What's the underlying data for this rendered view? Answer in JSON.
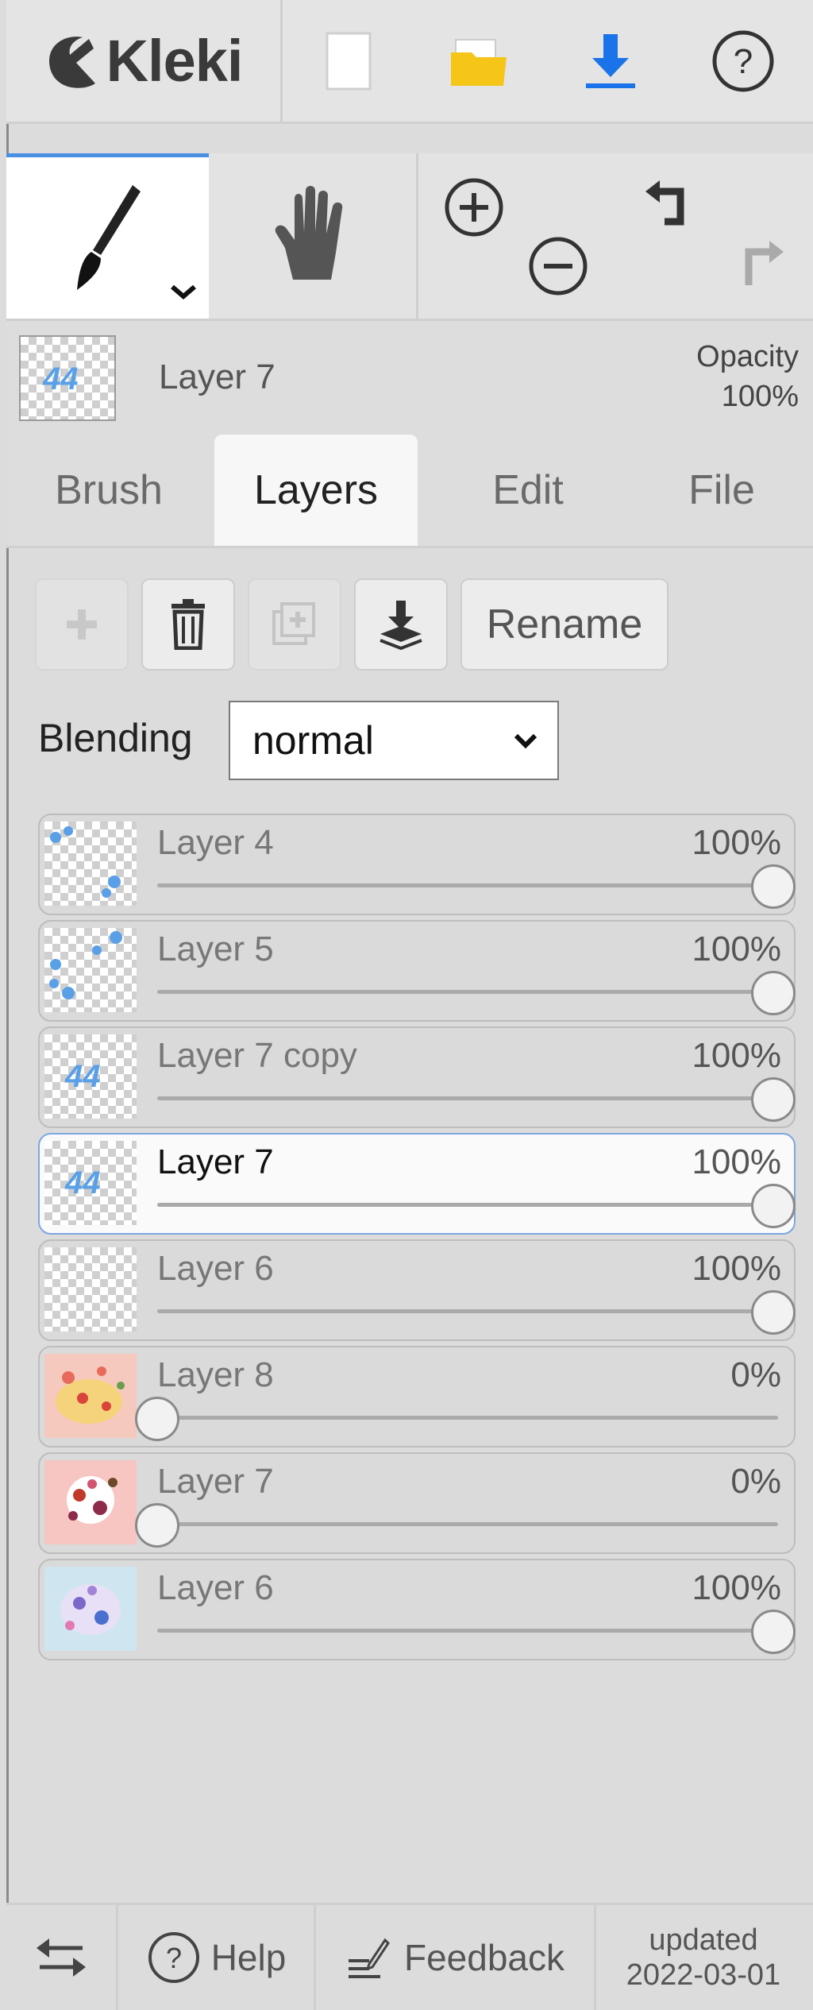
{
  "app": {
    "name": "Kleki"
  },
  "toolbar": {
    "icons": [
      "new-image-icon",
      "open-folder-icon",
      "download-icon",
      "help-icon"
    ],
    "accent_color": "#1a73e8",
    "folder_color": "#f5c518"
  },
  "tools": [
    "brush-tool-icon",
    "hand-tool-icon",
    "zoom-in-icon",
    "zoom-out-icon",
    "undo-icon",
    "redo-icon"
  ],
  "current_layer": {
    "name": "Layer 7",
    "opacity_label": "Opacity",
    "opacity_value": "100%"
  },
  "tabs": [
    {
      "label": "Brush",
      "active": false
    },
    {
      "label": "Layers",
      "active": true
    },
    {
      "label": "Edit",
      "active": false
    },
    {
      "label": "File",
      "active": false
    }
  ],
  "layer_actions": {
    "rename_label": "Rename",
    "icons": [
      "add-layer-icon",
      "delete-layer-icon",
      "duplicate-layer-icon",
      "merge-down-icon"
    ]
  },
  "blending": {
    "label": "Blending",
    "selected": "normal"
  },
  "layers": [
    {
      "name": "Layer 4",
      "opacity_label": "100%",
      "opacity": 1.0,
      "selected": false,
      "thumb": "blue-dots"
    },
    {
      "name": "Layer 5",
      "opacity_label": "100%",
      "opacity": 1.0,
      "selected": false,
      "thumb": "blue-dots"
    },
    {
      "name": "Layer 7 copy",
      "opacity_label": "100%",
      "opacity": 1.0,
      "selected": false,
      "thumb": "blue-44"
    },
    {
      "name": "Layer 7",
      "opacity_label": "100%",
      "opacity": 1.0,
      "selected": true,
      "thumb": "blue-44"
    },
    {
      "name": "Layer 6",
      "opacity_label": "100%",
      "opacity": 1.0,
      "selected": false,
      "thumb": "empty"
    },
    {
      "name": "Layer 8",
      "opacity_label": "0%",
      "opacity": 0.0,
      "selected": false,
      "thumb": "colorful-pink"
    },
    {
      "name": "Layer 7",
      "opacity_label": "0%",
      "opacity": 0.0,
      "selected": false,
      "thumb": "colorful-red"
    },
    {
      "name": "Layer 6",
      "opacity_label": "100%",
      "opacity": 1.0,
      "selected": false,
      "thumb": "colorful-blue"
    }
  ],
  "footer": {
    "help_label": "Help",
    "feedback_label": "Feedback",
    "updated_line1": "updated",
    "updated_line2": "2022-03-01"
  }
}
